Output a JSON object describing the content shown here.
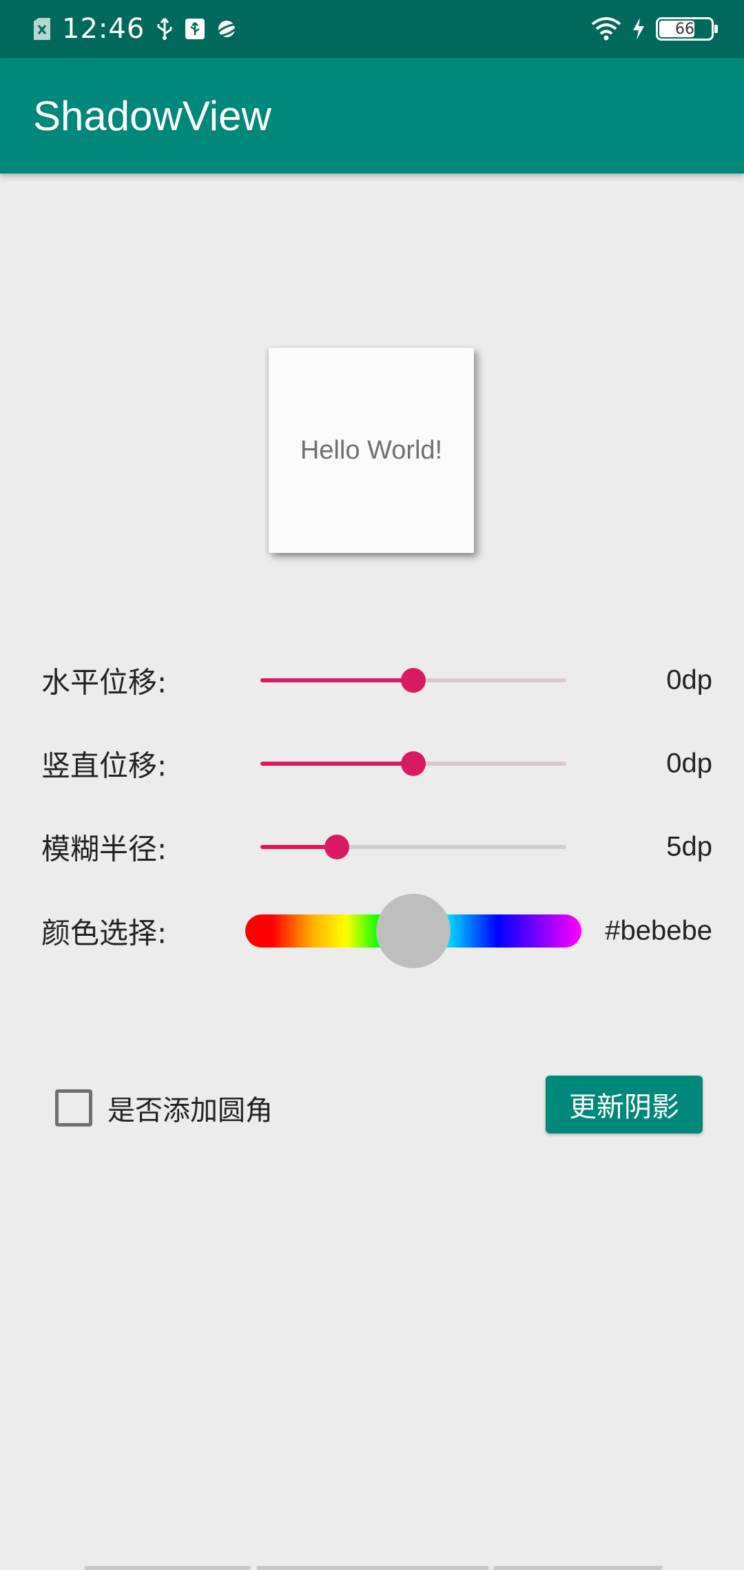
{
  "status_bar": {
    "time": "12:46",
    "battery_level": "66",
    "icons_left": [
      "sim-card-icon",
      "usb-icon",
      "usb-debug-icon",
      "planet-icon"
    ],
    "icons_right": [
      "wifi-icon",
      "charging-icon",
      "battery-icon"
    ]
  },
  "app_bar": {
    "title": "ShadowView"
  },
  "preview": {
    "text": "Hello World!"
  },
  "controls": {
    "horizontal": {
      "label": "水平位移:",
      "value": "0dp",
      "fraction": 0.5
    },
    "vertical": {
      "label": "竖直位移:",
      "value": "0dp",
      "fraction": 0.5
    },
    "blur": {
      "label": "模糊半径:",
      "value": "5dp",
      "fraction": 0.25
    },
    "color": {
      "label": "颜色选择:",
      "value": "#bebebe",
      "fraction": 0.5,
      "thumb_color": "#bebebe"
    }
  },
  "round_corner": {
    "label": "是否添加圆角",
    "checked": false
  },
  "update_button": {
    "label": "更新阴影"
  },
  "colors": {
    "primary": "#00897b",
    "primary_dark": "#00695c",
    "accent": "#d81b60"
  }
}
